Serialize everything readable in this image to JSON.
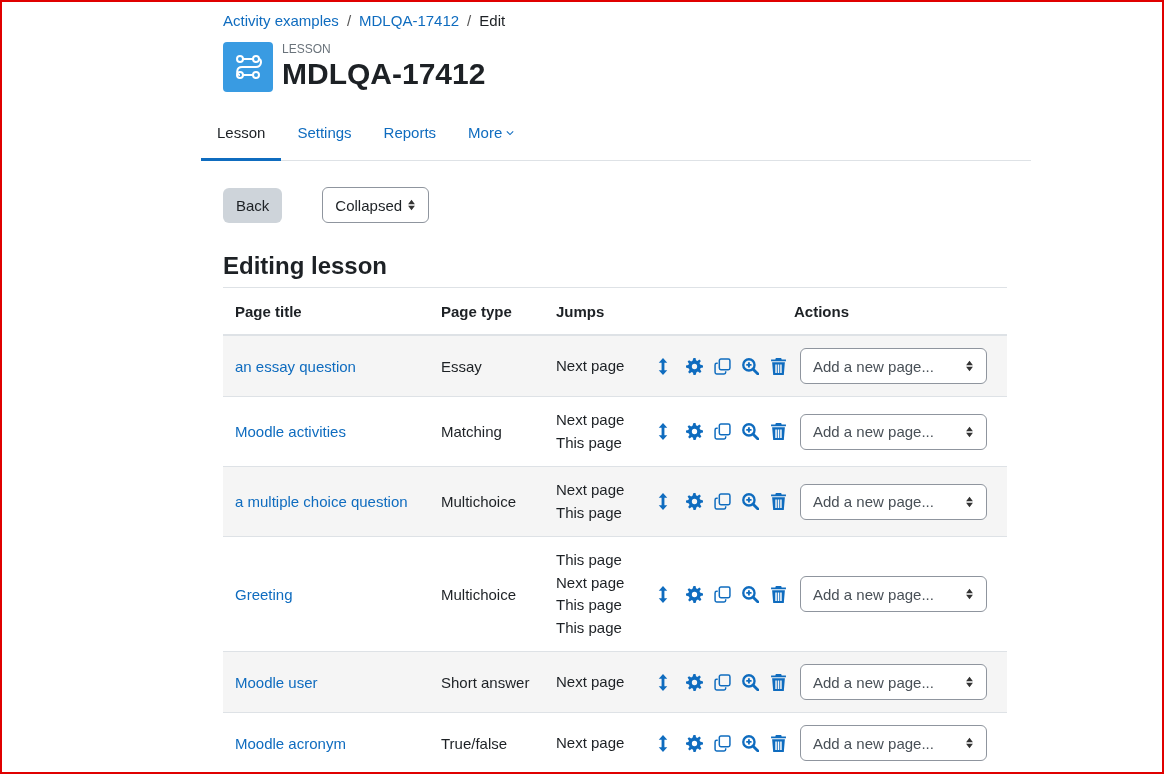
{
  "breadcrumb": [
    {
      "label": "Activity examples",
      "link": true
    },
    {
      "separator": "/",
      "label": "MDLQA-17412",
      "link": true
    },
    {
      "separator": "/",
      "label": "Edit",
      "link": false
    }
  ],
  "header": {
    "kicker": "LESSON",
    "title": "MDLQA-17412"
  },
  "tabs": [
    {
      "label": "Lesson",
      "selected": true
    },
    {
      "label": "Settings",
      "selected": false
    },
    {
      "label": "Reports",
      "selected": false
    },
    {
      "label": "More",
      "selected": false,
      "dropdown": true
    }
  ],
  "toolbar": {
    "back": "Back",
    "view_mode": "Collapsed"
  },
  "section_title": "Editing lesson",
  "table": {
    "columns": [
      "Page title",
      "Page type",
      "Jumps",
      "Actions"
    ],
    "rows": [
      {
        "title": "an essay question",
        "type": "Essay",
        "jumps": [
          "Next page"
        ],
        "add_page": "Add a new page..."
      },
      {
        "title": "Moodle activities",
        "type": "Matching",
        "jumps": [
          "Next page",
          "This page"
        ],
        "add_page": "Add a new page..."
      },
      {
        "title": "a multiple choice question",
        "type": "Multichoice",
        "jumps": [
          "Next page",
          "This page"
        ],
        "add_page": "Add a new page..."
      },
      {
        "title": "Greeting",
        "type": "Multichoice",
        "jumps": [
          "This page",
          "Next page",
          "This page",
          "This page"
        ],
        "add_page": "Add a new page..."
      },
      {
        "title": "Moodle user",
        "type": "Short answer",
        "jumps": [
          "Next page"
        ],
        "add_page": "Add a new page..."
      },
      {
        "title": "Moodle acronym",
        "type": "True/false",
        "jumps": [
          "Next page"
        ],
        "add_page": "Add a new page..."
      }
    ]
  }
}
